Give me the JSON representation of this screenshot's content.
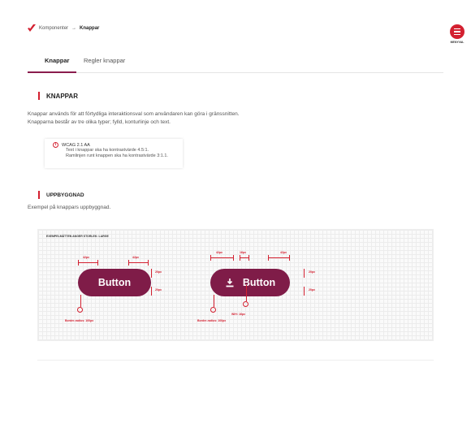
{
  "breadcrumb": {
    "parent": "Komponenter",
    "separator": "→",
    "current": "Knappar"
  },
  "menu": {
    "label": "MENYVAL",
    "icon": "hamburger-icon"
  },
  "tabs": [
    {
      "label": "Knappar",
      "active": true
    },
    {
      "label": "Regler knappar",
      "active": false
    }
  ],
  "section1": {
    "title": "KNAPPAR",
    "text1": "Knappar används för att förtydliga interaktionsval som användaren kan göra i gränssnitten.",
    "text2": "Knapparna består av tre olika typer; fylld, konturlinje och text."
  },
  "wcag": {
    "title": "WCAG 2.1 AA",
    "line1": "Text i knappar ska ha kontrastvärde 4.5:1.",
    "line2": "Ramlinjen runt knappen ska ha kontrastvärde 3:1.1."
  },
  "section2": {
    "title": "UPPBYGGNAD",
    "text": "Exempel på knappars uppbyggnad."
  },
  "example": {
    "label": "EXEMPELMÅTTEN ANGER STORLEK: LARGE",
    "button_label": "Button",
    "button2_icon": "download-icon",
    "m42": "42px",
    "m16": "16px",
    "m20": "20px",
    "radius": "Border-radius: 100px",
    "icon_size": "W/H: 16px"
  },
  "colors": {
    "brand": "#7f1c48",
    "accent": "#d32030"
  }
}
